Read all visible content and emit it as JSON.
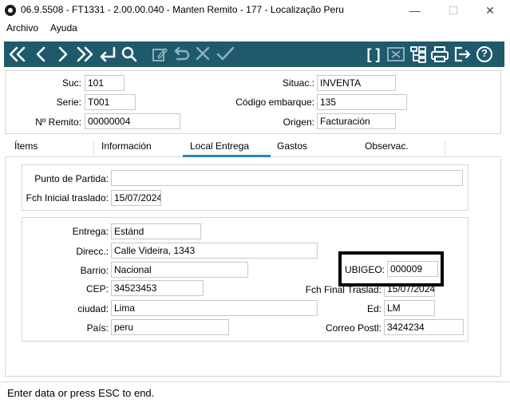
{
  "window": {
    "title": "06.9.5508 - FT1331 - 2.00.00.040 - Manten Remito - 177 - Localização Peru",
    "minimize_glyph": "—",
    "maximize_glyph": "☐",
    "close_glyph": "✕"
  },
  "menu": {
    "items": [
      "Archivo",
      "Ayuda"
    ]
  },
  "toolbar": {
    "icons": [
      "first-icon",
      "prev-icon",
      "next-icon",
      "last-icon",
      "return-icon",
      "search-icon",
      "edit-icon",
      "undo-icon",
      "cancel-icon",
      "confirm-icon",
      "brackets-icon",
      "delete-icon",
      "tree-icon",
      "print-icon",
      "exit-icon",
      "help-icon"
    ],
    "brackets_text": "[ ]",
    "help_text": "?",
    "colors": {
      "background": "#1e5a6b",
      "icon": "#ffffff",
      "icon_disabled": "#8fb0ba"
    }
  },
  "header": {
    "suc_label": "Suc:",
    "suc_value": "101",
    "serie_label": "Serie:",
    "serie_value": "T001",
    "remito_label": "Nº Remito:",
    "remito_value": "00000004",
    "situac_label": "Situac.:",
    "situac_value": "INVENTA",
    "codigo_label": "Código embarque:",
    "codigo_value": "135",
    "origen_label": "Origen:",
    "origen_value": "Facturación"
  },
  "tabs": {
    "items": [
      "Ítems",
      "Información",
      "Local Entrega",
      "Gastos",
      "Observac."
    ],
    "active": "Local Entrega",
    "active_color": "#2a82c4"
  },
  "partida": {
    "punto_label": "Punto de Partida:",
    "punto_value": "",
    "fecha_label": "Fch Inicial traslado:",
    "fecha_value": "15/07/2024"
  },
  "entrega": {
    "entrega_label": "Entrega:",
    "entrega_value": "Estánd",
    "direcc_label": "Direcc.:",
    "direcc_value": "Calle Videira, 1343",
    "barrio_label": "Barrio:",
    "barrio_value": "Nacional",
    "cep_label": "CEP:",
    "cep_value": "34523453",
    "ciudad_label": "ciudad:",
    "ciudad_value": "Lima",
    "pais_label": "País:",
    "pais_value": "peru",
    "ubigeo_label": "UBIGEO:",
    "ubigeo_value": "000009",
    "fch_final_label": "Fch Final Traslad:",
    "fch_final_value": "15/07/2024",
    "ed_label": "Ed:",
    "ed_value": "LM",
    "correo_label": "Correo Postl:",
    "correo_value": "3424234"
  },
  "status": {
    "text": "Enter data or press ESC to end."
  }
}
